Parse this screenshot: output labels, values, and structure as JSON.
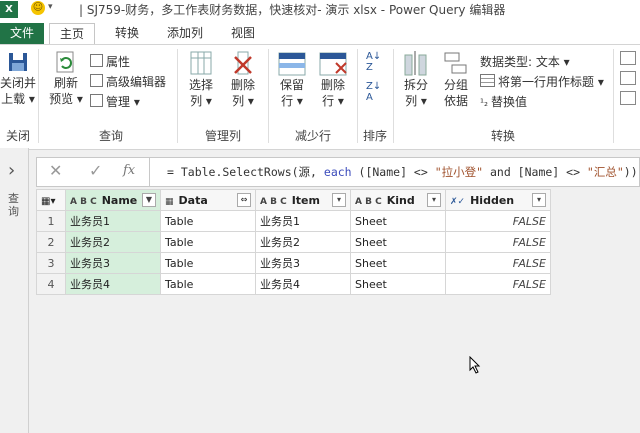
{
  "titlebar": {
    "title": "| SJ759-财务，多工作表财务数据，快速核对- 演示 xlsx - Power Query 编辑器",
    "app_badge": "X",
    "qat_dropdown": "▾"
  },
  "tabs": {
    "file": "文件",
    "home": "主页",
    "transform": "转换",
    "add_column": "添加列",
    "view": "视图"
  },
  "ribbon": {
    "close": {
      "line1": "关闭并",
      "line2": "上载 ▾",
      "group": "关闭"
    },
    "query": {
      "refresh1": "刷新",
      "refresh2": "预览 ▾",
      "properties": "属性",
      "advanced_editor": "高级编辑器",
      "manage": "管理 ▾",
      "group": "查询"
    },
    "manage_columns": {
      "choose1": "选择",
      "choose2": "列 ▾",
      "remove1": "删除",
      "remove2": "列 ▾",
      "group": "管理列"
    },
    "reduce_rows": {
      "keep1": "保留",
      "keep2": "行 ▾",
      "remove1": "删除",
      "remove2": "行 ▾",
      "group": "减少行"
    },
    "sort": {
      "group": "排序"
    },
    "transform": {
      "split1": "拆分",
      "split2": "列 ▾",
      "group1": "分组",
      "group2": "依据",
      "datatype": "数据类型: 文本 ▾",
      "first_row": "将第一行用作标题 ▾",
      "replace": "替换值",
      "group": "转换"
    }
  },
  "leftnav": {
    "label": "查询",
    "arrow": "›"
  },
  "formula": {
    "cancel": "✕",
    "confirm": "✓",
    "fx": "fx",
    "p1": "= Table.SelectRows(源, ",
    "kw": "each",
    "p2": " ([Name] <> ",
    "s1": "\"拉小登\"",
    "p3": " and [Name] <> ",
    "s2": "\"汇总\"",
    "p4": "))"
  },
  "grid": {
    "columns": [
      {
        "type": "A B C",
        "name": "Name",
        "btn": "▼"
      },
      {
        "type": "▦",
        "name": "Data",
        "btn": "⇔"
      },
      {
        "type": "A B C",
        "name": "Item",
        "btn": "▾"
      },
      {
        "type": "A B C",
        "name": "Kind",
        "btn": "▾"
      },
      {
        "type": "✗✓",
        "name": "Hidden",
        "btn": "▾"
      }
    ],
    "rows": [
      {
        "n": "1",
        "name": "业务员1",
        "data": "Table",
        "item": "业务员1",
        "kind": "Sheet",
        "hidden": "FALSE"
      },
      {
        "n": "2",
        "name": "业务员2",
        "data": "Table",
        "item": "业务员2",
        "kind": "Sheet",
        "hidden": "FALSE"
      },
      {
        "n": "3",
        "name": "业务员3",
        "data": "Table",
        "item": "业务员3",
        "kind": "Sheet",
        "hidden": "FALSE"
      },
      {
        "n": "4",
        "name": "业务员4",
        "data": "Table",
        "item": "业务员4",
        "kind": "Sheet",
        "hidden": "FALSE"
      }
    ]
  },
  "colors": {
    "excel_green": "#217346",
    "selected_col": "#d6efdc"
  }
}
